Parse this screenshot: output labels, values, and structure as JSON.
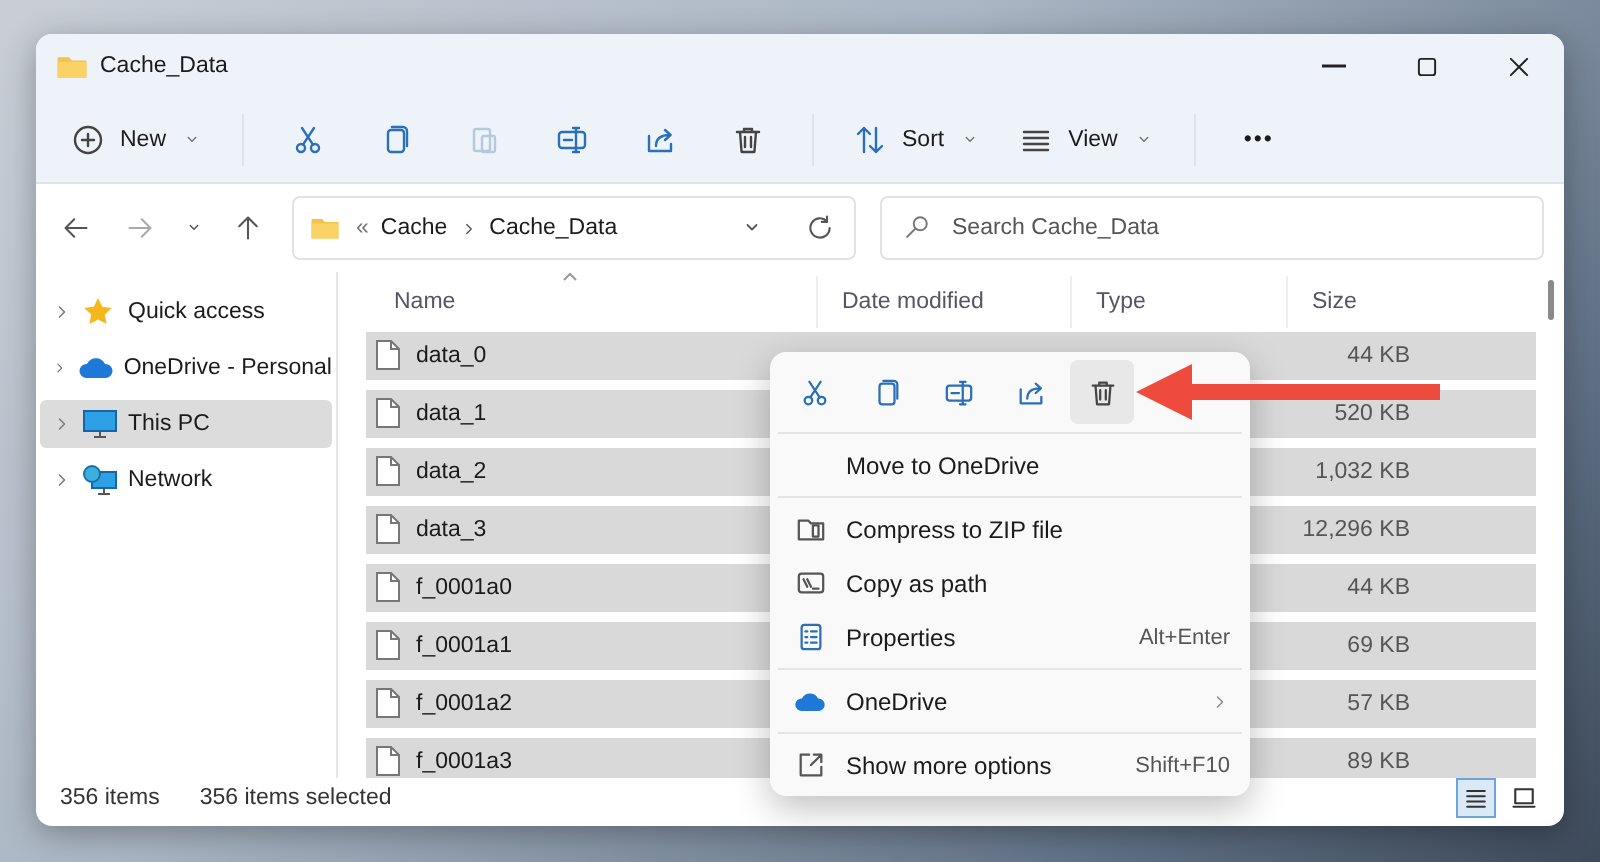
{
  "window": {
    "title": "Cache_Data"
  },
  "toolbar": [
    {
      "kind": "menu",
      "label": "New",
      "disabled": false
    },
    {
      "kind": "icon",
      "disabled": false
    },
    {
      "kind": "icon",
      "disabled": false
    },
    {
      "kind": "icon",
      "disabled": true
    },
    {
      "kind": "icon",
      "disabled": false
    },
    {
      "kind": "icon",
      "disabled": false
    },
    {
      "kind": "icon",
      "disabled": false
    },
    {
      "kind": "menu",
      "label": "Sort",
      "disabled": false
    },
    {
      "kind": "menu",
      "label": "View",
      "disabled": false
    },
    {
      "kind": "more",
      "label": "•••",
      "disabled": false
    }
  ],
  "address": {
    "overflow": "«",
    "path": [
      "Cache",
      "Cache_Data"
    ],
    "search": {
      "placeholder": "Search Cache_Data"
    }
  },
  "sidebar": {
    "items": [
      {
        "label": "Quick access",
        "selected": false
      },
      {
        "label": "OneDrive - Personal",
        "selected": false
      },
      {
        "label": "This PC",
        "selected": true
      },
      {
        "label": "Network",
        "selected": false
      }
    ]
  },
  "table": {
    "columns": [
      "Name",
      "Date modified",
      "Type",
      "Size"
    ],
    "rows": [
      {
        "name": "data_0",
        "size": "44 KB",
        "selected": true
      },
      {
        "name": "data_1",
        "size": "520 KB",
        "selected": true
      },
      {
        "name": "data_2",
        "size": "1,032 KB",
        "selected": true
      },
      {
        "name": "data_3",
        "size": "12,296 KB",
        "selected": true
      },
      {
        "name": "f_0001a0",
        "size": "44 KB",
        "selected": true
      },
      {
        "name": "f_0001a1",
        "size": "69 KB",
        "selected": true
      },
      {
        "name": "f_0001a2",
        "size": "57 KB",
        "selected": true
      },
      {
        "name": "f_0001a3",
        "size": "89 KB",
        "selected": true
      }
    ]
  },
  "status_bar": {
    "count": "356 items",
    "selection": "356 items selected",
    "views": [
      {
        "selected": true
      },
      {
        "selected": false
      }
    ]
  },
  "context_menu": {
    "actions": [
      {
        "selected": false
      },
      {
        "selected": false
      },
      {
        "selected": false
      },
      {
        "selected": false
      },
      {
        "selected": true
      }
    ],
    "items": [
      {
        "kind": "item",
        "label": "Move to OneDrive"
      },
      {
        "kind": "separator"
      },
      {
        "kind": "item",
        "label": "Compress to ZIP file"
      },
      {
        "kind": "item",
        "label": "Copy as path"
      },
      {
        "kind": "item",
        "label": "Properties",
        "shortcut": "Alt+Enter"
      },
      {
        "kind": "separator"
      },
      {
        "kind": "submenu",
        "label": "OneDrive"
      },
      {
        "kind": "separator"
      },
      {
        "kind": "item",
        "label": "Show more options",
        "shortcut": "Shift+F10"
      }
    ]
  }
}
